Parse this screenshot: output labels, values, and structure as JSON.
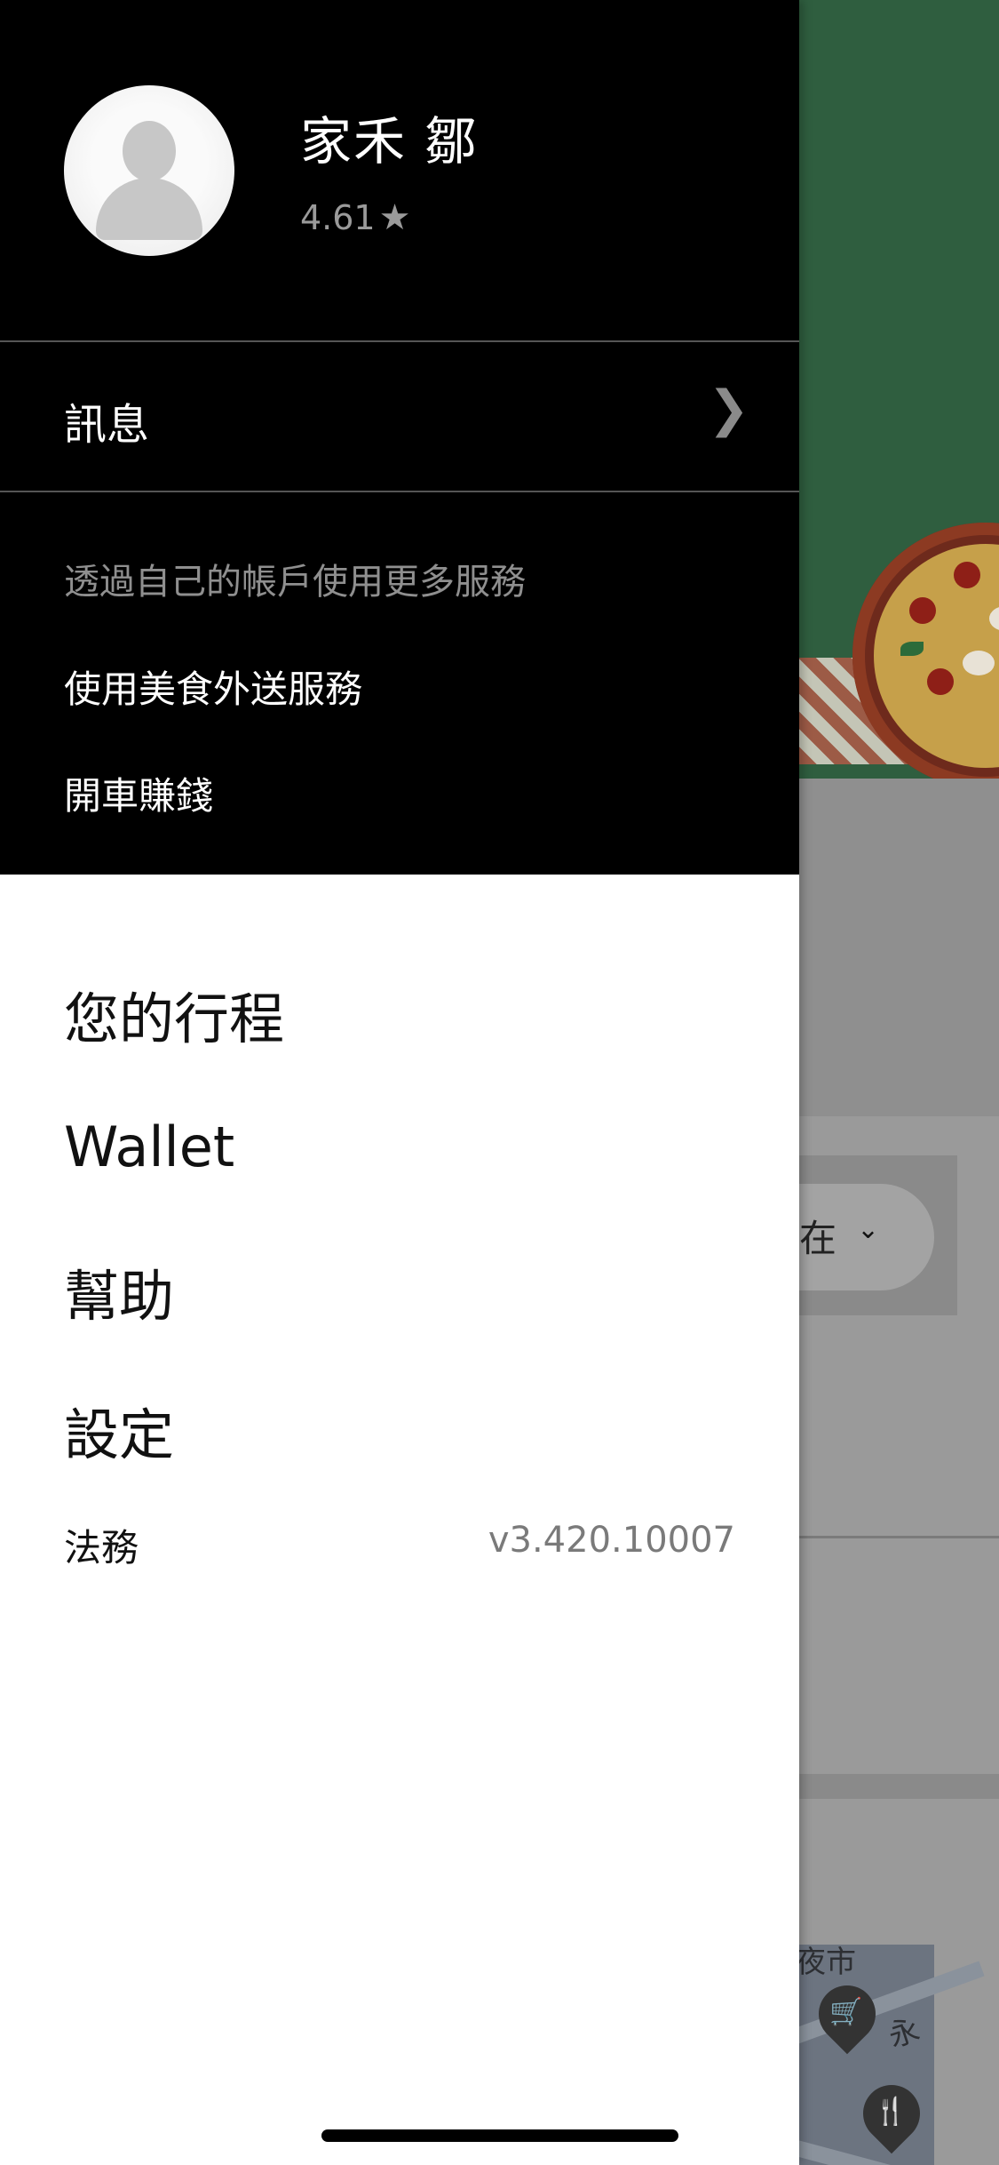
{
  "profile": {
    "name": "家禾 鄒",
    "rating": "4.61",
    "rating_icon": "star-icon"
  },
  "messages": {
    "label": "訊息",
    "chevron": "❯"
  },
  "more_services": {
    "heading": "透過自己的帳戶使用更多服務",
    "links": [
      "使用美食外送服務",
      "開車賺錢"
    ]
  },
  "menu": {
    "items": [
      "您的行程",
      "Wallet",
      "幫助",
      "設定"
    ]
  },
  "footer": {
    "legal": "法務",
    "version": "v3.420.10007"
  },
  "background_app": {
    "partial_text": "在",
    "map_label_1": "夜市",
    "map_label_2": "永"
  },
  "colors": {
    "drawer_dark": "#000000",
    "drawer_light": "#ffffff",
    "hero_green": "#2f5e3f"
  }
}
